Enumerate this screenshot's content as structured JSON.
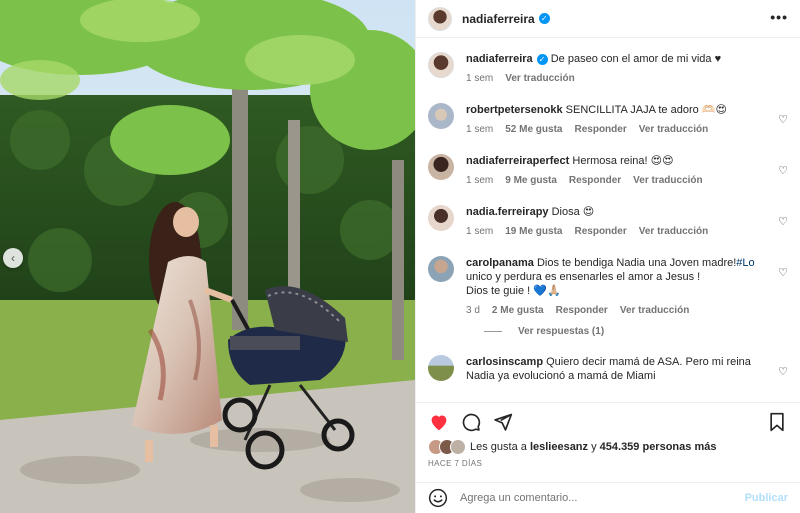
{
  "post": {
    "author": "nadiaferreira",
    "caption": "De paseo con el amor de mi vida ♥",
    "age": "1 sem",
    "translate": "Ver traducción"
  },
  "comments": [
    {
      "user": "robertpetersenokk",
      "text": "SENCILLITA JAJA te adoro 🫶🏻😍",
      "age": "1 sem",
      "likes": "52 Me gusta",
      "reply": "Responder",
      "translate": "Ver traducción"
    },
    {
      "user": "nadiaferreiraperfect",
      "text": "Hermosa reina! 😍😍",
      "age": "1 sem",
      "likes": "9 Me gusta",
      "reply": "Responder",
      "translate": "Ver traducción"
    },
    {
      "user": "nadia.ferreirapy",
      "text": "Diosa 😍",
      "age": "1 sem",
      "likes": "19 Me gusta",
      "reply": "Responder",
      "translate": "Ver traducción"
    },
    {
      "user": "carolpanama",
      "text_before": "Dios te bendiga Nadia una Joven madre!",
      "hashtag": "#Lo",
      "text_after_1": "unico y perdura es ensenarles el amor a Jesus !",
      "text_after_2": "Dios te guie ! 💙🙏🏼",
      "age": "3 d",
      "likes": "2 Me gusta",
      "reply": "Responder",
      "translate": "Ver traducción",
      "view_replies": "Ver respuestas (1)"
    },
    {
      "user": "carlosinscamp",
      "text_1": "Quiero decir mamá de ASA. Pero mi reina",
      "text_2": "Nadia ya evolucionó a mamá de Miami"
    }
  ],
  "likes_summary": {
    "prefix": "Les gusta a",
    "user": "leslieesanz",
    "connector": "y",
    "others": "454.359 personas más"
  },
  "posted_ago": "HACE 7 DÍAS",
  "composer": {
    "placeholder": "Agrega un comentario...",
    "post_label": "Publicar"
  },
  "colors": {
    "like_red": "#ff3040",
    "verified_blue": "#0095f6",
    "link": "#00376b",
    "muted": "#737373"
  },
  "icons": [
    "chevron-left-icon",
    "verified-icon",
    "more-icon",
    "heart-icon",
    "comment-icon",
    "share-icon",
    "bookmark-icon",
    "emoji-icon"
  ]
}
